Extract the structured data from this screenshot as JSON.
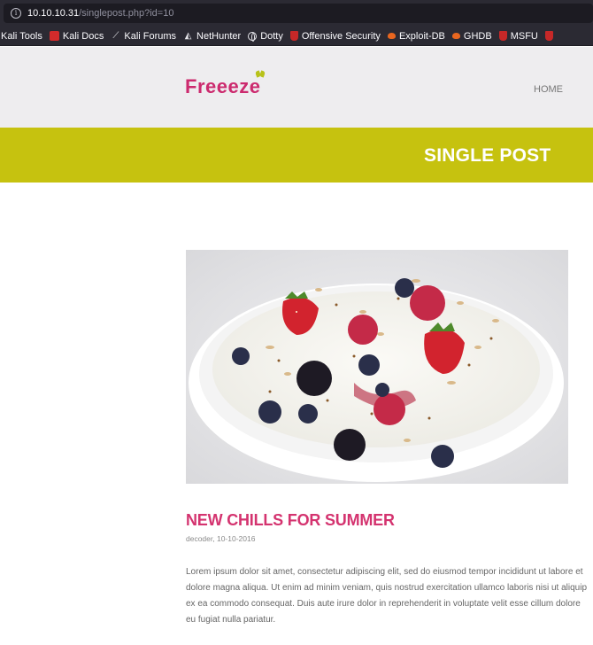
{
  "browser": {
    "info_icon": "info-icon",
    "url_host": "10.10.10.31",
    "url_path": "/singlepost.php?id=10",
    "bookmarks": [
      {
        "label": "Kali Tools",
        "icon": "none"
      },
      {
        "label": "Kali Docs",
        "icon": "kali-docs-icon"
      },
      {
        "label": "Kali Forums",
        "icon": "dragon-icon"
      },
      {
        "label": "NetHunter",
        "icon": "nethunter-icon"
      },
      {
        "label": "Dotty",
        "icon": "globe-icon"
      },
      {
        "label": "Offensive Security",
        "icon": "offsec-icon"
      },
      {
        "label": "Exploit-DB",
        "icon": "exploitdb-icon"
      },
      {
        "label": "GHDB",
        "icon": "ghdb-icon"
      },
      {
        "label": "MSFU",
        "icon": "offsec-icon"
      }
    ]
  },
  "site": {
    "logo": "Freeeze",
    "nav_home": "HOME",
    "banner_title": "SINGLE POST",
    "brand_color": "#cc2a6e",
    "banner_color": "#c6c20f"
  },
  "post": {
    "image": "yogurt-bowl-with-berries-image",
    "title": "NEW CHILLS FOR SUMMER",
    "meta": "decoder, 10-10-2016",
    "body": "Lorem ipsum dolor sit amet, consectetur adipiscing elit, sed do eiusmod tempor incididunt ut labore et dolore magna aliqua. Ut enim ad minim veniam, quis nostrud exercitation ullamco laboris nisi ut aliquip ex ea commodo consequat. Duis aute irure dolor in reprehenderit in voluptate velit esse cillum dolore eu fugiat nulla pariatur."
  }
}
